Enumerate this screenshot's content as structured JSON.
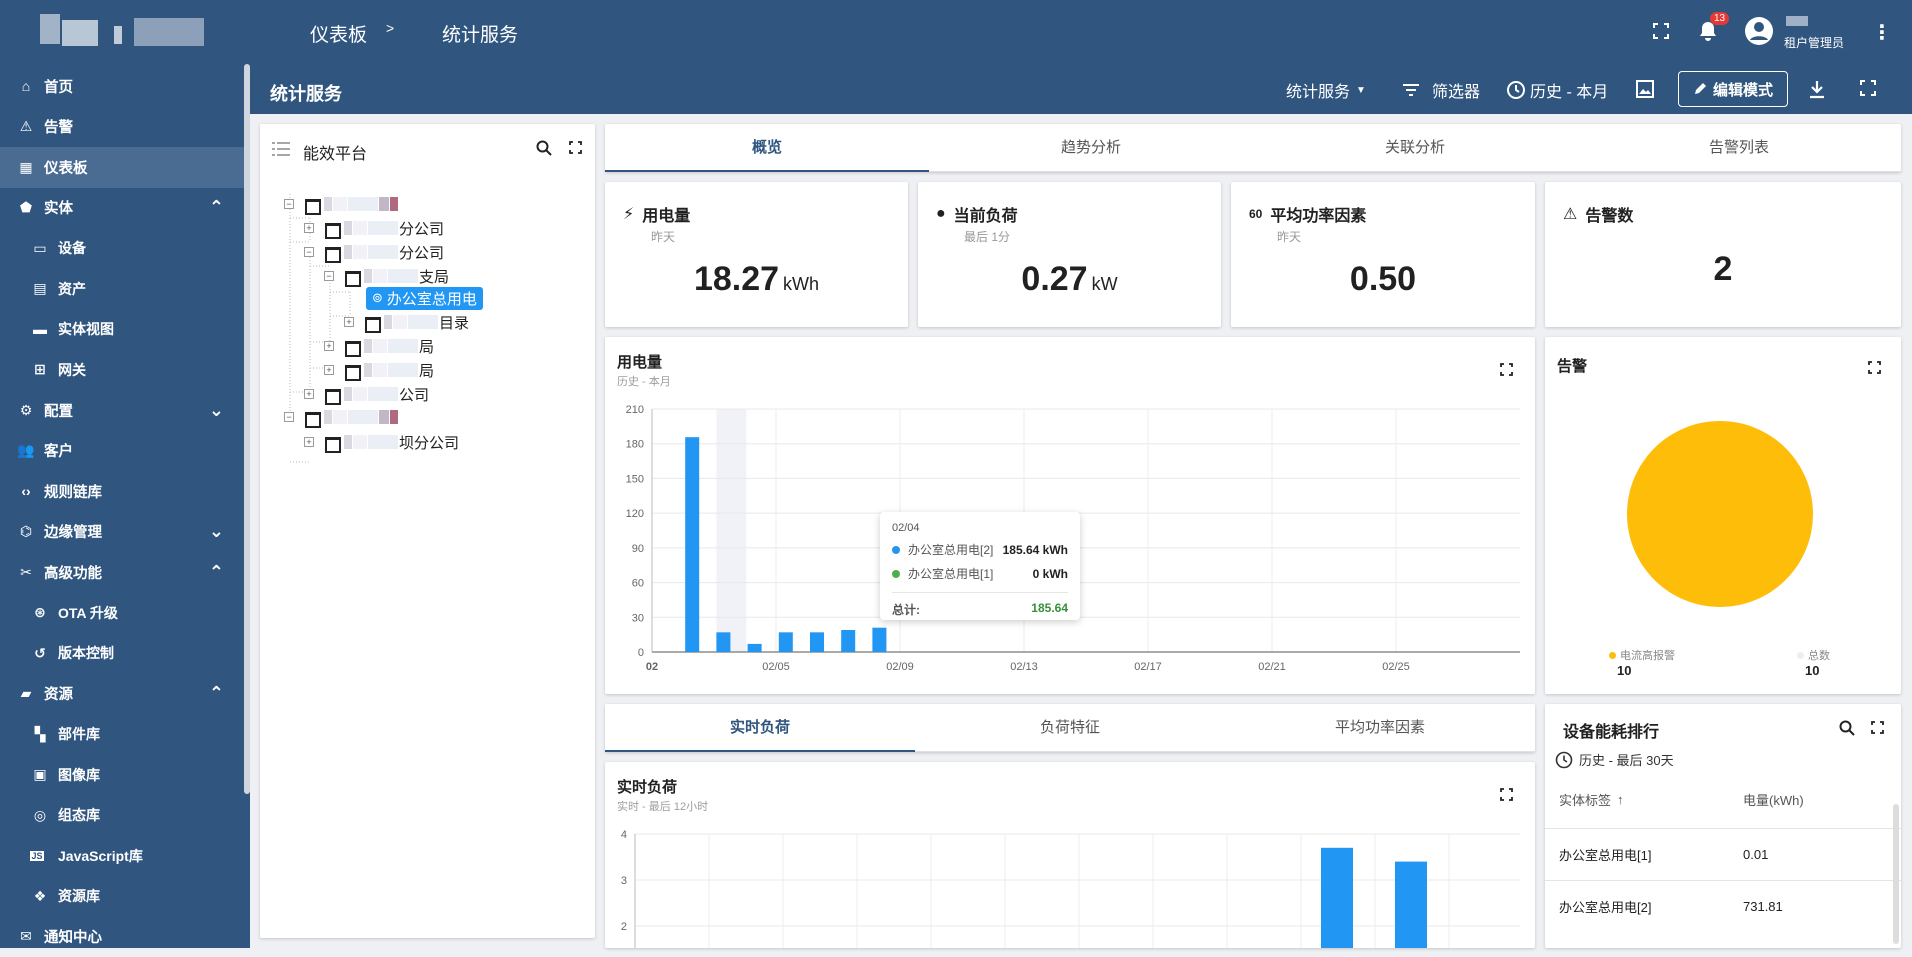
{
  "breadcrumb": {
    "dashboard": "仪表板",
    "separator": ">",
    "current": "统计服务"
  },
  "user": {
    "role": "租户管理员",
    "notifications": "13"
  },
  "sidebar": {
    "items": [
      {
        "label": "首页",
        "icon": "home-icon"
      },
      {
        "label": "告警",
        "icon": "warning-icon"
      },
      {
        "label": "仪表板",
        "icon": "dashboard-icon",
        "active": true
      },
      {
        "label": "实体",
        "icon": "entity-icon",
        "expanded": true
      },
      {
        "label": "设备",
        "icon": "device-icon",
        "sub": true
      },
      {
        "label": "资产",
        "icon": "asset-icon",
        "sub": true
      },
      {
        "label": "实体视图",
        "icon": "entity-view-icon",
        "sub": true
      },
      {
        "label": "网关",
        "icon": "gateway-icon",
        "sub": true
      },
      {
        "label": "配置",
        "icon": "config-icon",
        "expanded": false
      },
      {
        "label": "客户",
        "icon": "customers-icon"
      },
      {
        "label": "规则链库",
        "icon": "rule-chain-icon"
      },
      {
        "label": "边缘管理",
        "icon": "edge-icon",
        "expanded": false
      },
      {
        "label": "高级功能",
        "icon": "tools-icon",
        "expanded": true
      },
      {
        "label": "OTA 升级",
        "icon": "ota-icon",
        "sub": true
      },
      {
        "label": "版本控制",
        "icon": "history-icon",
        "sub": true
      },
      {
        "label": "资源",
        "icon": "folder-icon",
        "expanded": true
      },
      {
        "label": "部件库",
        "icon": "widgets-icon",
        "sub": true
      },
      {
        "label": "图像库",
        "icon": "image-icon",
        "sub": true
      },
      {
        "label": "组态库",
        "icon": "scada-icon",
        "sub": true
      },
      {
        "label": "JavaScript库",
        "icon": "javascript-icon",
        "sub": true
      },
      {
        "label": "资源库",
        "icon": "resources-icon",
        "sub": true
      },
      {
        "label": "通知中心",
        "icon": "notification-center-icon"
      }
    ]
  },
  "toolbar": {
    "title": "统计服务",
    "dashboard_select": "统计服务",
    "filter": "筛选器",
    "timewindow": "历史 - 本月",
    "edit": "编辑模式"
  },
  "tree": {
    "title": "能效平台",
    "nodes": [
      {
        "label": "",
        "level": 0,
        "expander": "−"
      },
      {
        "label": "分公司",
        "level": 1,
        "expander": "+"
      },
      {
        "label": "分公司",
        "level": 1,
        "expander": "−"
      },
      {
        "label": "支局",
        "level": 2,
        "expander": "−"
      },
      {
        "label": "办公室总用电",
        "level": 3,
        "selected": true
      },
      {
        "label": "目录",
        "level": 3,
        "expander": "+"
      },
      {
        "label": "局",
        "level": 2,
        "expander": "+"
      },
      {
        "label": "局",
        "level": 2,
        "expander": "+"
      },
      {
        "label": "公司",
        "level": 1,
        "expander": "+"
      },
      {
        "label": "",
        "level": 0,
        "expander": "−"
      },
      {
        "label": "坝分公司",
        "level": 1,
        "expander": "+"
      }
    ]
  },
  "main_tabs": [
    "概览",
    "趋势分析",
    "关联分析",
    "告警列表"
  ],
  "stats": [
    {
      "title": "用电量",
      "sub": "昨天",
      "value": "18.27",
      "unit": "kWh",
      "icon": "power-plug-icon"
    },
    {
      "title": "当前负荷",
      "sub": "最后 1分",
      "value": "0.27",
      "unit": "kW",
      "icon": "load-icon"
    },
    {
      "title": "平均功率因素",
      "sub": "昨天",
      "value": "0.50",
      "unit": "",
      "icon": "power-factor-icon"
    },
    {
      "title": "告警数",
      "sub": "",
      "value": "2",
      "unit": "",
      "icon": "warning-icon"
    }
  ],
  "energy_chart": {
    "title": "用电量",
    "sub": "历史 - 本月"
  },
  "tooltip": {
    "date": "02/04",
    "rows": [
      {
        "name": "办公室总用电[2]",
        "value": "185.64 kWh",
        "color": "#2196f3"
      },
      {
        "name": "办公室总用电[1]",
        "value": "0 kWh",
        "color": "#4caf50"
      }
    ],
    "total_label": "总计:",
    "total_value": "185.64"
  },
  "alarm_chart": {
    "title": "告警",
    "legend": [
      {
        "name": "电流高报警",
        "value": "10",
        "color": "#fdbd08"
      },
      {
        "name": "总数",
        "value": "10",
        "color": "#eeeeee"
      }
    ]
  },
  "lower_tabs": [
    "实时负荷",
    "负荷特征",
    "平均功率因素"
  ],
  "realtime_chart": {
    "title": "实时负荷",
    "sub": "实时 - 最后 12小时"
  },
  "ranking": {
    "title": "设备能耗排行",
    "timewindow": "历史 - 最后 30天",
    "columns": [
      "实体标签",
      "电量(kWh)"
    ],
    "rows": [
      {
        "label": "办公室总用电[1]",
        "value": "0.01"
      },
      {
        "label": "办公室总用电[2]",
        "value": "731.81"
      }
    ]
  },
  "chart_data": [
    {
      "type": "bar",
      "title": "用电量",
      "x": [
        "02/03",
        "02/04",
        "02/05",
        "02/06",
        "02/07",
        "02/08",
        "02/09"
      ],
      "series": [
        {
          "name": "办公室总用电[2]",
          "values": [
            185.64,
            17,
            7,
            17,
            17,
            19,
            21
          ]
        }
      ],
      "xticks": [
        "02",
        "02/05",
        "02/09",
        "02/13",
        "02/17",
        "02/21",
        "02/25"
      ],
      "yticks": [
        0,
        30,
        60,
        90,
        120,
        150,
        180,
        210
      ],
      "ylim": [
        0,
        210
      ],
      "highlight_category": "02/04"
    },
    {
      "type": "pie",
      "title": "告警",
      "slices": [
        {
          "name": "电流高报警",
          "value": 10
        }
      ]
    },
    {
      "type": "bar",
      "title": "实时负荷",
      "values": [
        3.7,
        3.4
      ],
      "yticks": [
        2,
        3,
        4
      ]
    }
  ]
}
